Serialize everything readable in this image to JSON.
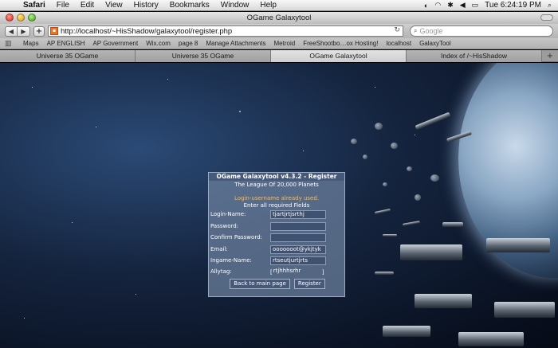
{
  "menubar": {
    "app": "Safari",
    "items": [
      "File",
      "Edit",
      "View",
      "History",
      "Bookmarks",
      "Window",
      "Help"
    ],
    "clock": "Tue 6:24:19 PM"
  },
  "window": {
    "title": "OGame Galaxytool"
  },
  "toolbar": {
    "back_icon": "back-arrow-icon",
    "forward_icon": "forward-arrow-icon",
    "url": "http://localhost/~HisShadow/galaxytool/register.php",
    "search_placeholder": "Google"
  },
  "bookmarks": [
    "Maps",
    "AP ENGLISH",
    "AP Government",
    "Wix.com",
    "page 8",
    "Manage Attachments",
    "Metroid",
    "FreeShootbo…ox Hosting!",
    "localhost",
    "GalaxyTool"
  ],
  "tabs": [
    {
      "label": "Universe 35 OGame",
      "active": false
    },
    {
      "label": "Universe 35 OGame",
      "active": false
    },
    {
      "label": "OGame Galaxytool",
      "active": true
    },
    {
      "label": "Index of /~HisShadow",
      "active": false
    }
  ],
  "register": {
    "title": "OGame Galaxytool v4.3.2 - Register",
    "subtitle": "The League Of 20,000 Planets",
    "error": "Login-username already used.",
    "info": "Enter all required Fields",
    "fields": [
      {
        "label": "Login-Name:",
        "value": "tjartjrtjsrthj"
      },
      {
        "label": "Password:",
        "value": ""
      },
      {
        "label": "Confirm Password:",
        "value": ""
      },
      {
        "label": "Email:",
        "value": "ooooooot@ykjtyk"
      },
      {
        "label": "Ingame-Name:",
        "value": "rtseutjurtjrts"
      }
    ],
    "allytag": {
      "label": "Allytag:",
      "open": "[",
      "value": "rtjhhhsrhr",
      "close": "]"
    },
    "back_button": "Back to main page",
    "register_button": "Register"
  }
}
